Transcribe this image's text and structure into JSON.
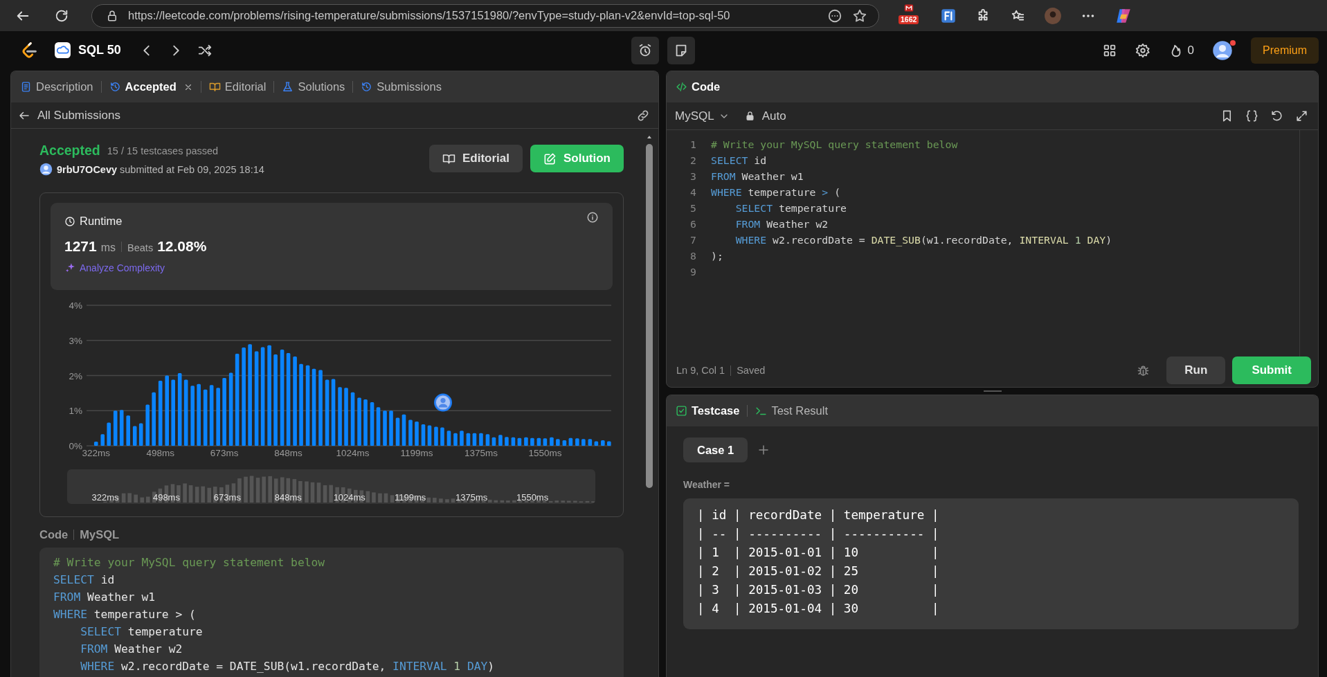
{
  "browser": {
    "url": "https://leetcode.com/problems/rising-temperature/submissions/1537151980/?envType=study-plan-v2&envId=top-sql-50",
    "mail_badge": "1662"
  },
  "navbar": {
    "study_plan": "SQL 50",
    "streak_count": "0",
    "premium_button": "Premium"
  },
  "left_panel": {
    "tabs": [
      {
        "label": "Description",
        "kind": "description",
        "selected": false,
        "closable": false
      },
      {
        "label": "Accepted",
        "kind": "history",
        "selected": true,
        "closable": true
      },
      {
        "label": "Editorial",
        "kind": "book",
        "selected": false,
        "closable": false
      },
      {
        "label": "Solutions",
        "kind": "flask",
        "selected": false,
        "closable": false
      },
      {
        "label": "Submissions",
        "kind": "history",
        "selected": false,
        "closable": false
      }
    ],
    "back_link": "All Submissions",
    "submission": {
      "status": "Accepted",
      "testcases": "15 / 15 testcases passed",
      "user": "9rbU7OCevy",
      "submitted": "submitted at Feb 09, 2025 18:14",
      "buttons": [
        {
          "label": "Editorial",
          "kind": "secondary"
        },
        {
          "label": "Solution",
          "kind": "primary"
        }
      ]
    },
    "runtime": {
      "title": "Runtime",
      "value": "1271",
      "unit": "ms",
      "beats_label": "Beats",
      "beats_value": "12.08%",
      "analyze_link": "Analyze Complexity",
      "chart_data": {
        "type": "bar",
        "x": [
          322,
          340,
          357,
          375,
          392,
          410,
          428,
          445,
          463,
          480,
          498,
          516,
          533,
          551,
          568,
          586,
          603,
          621,
          638,
          656,
          673,
          691,
          708,
          726,
          743,
          761,
          778,
          796,
          813,
          831,
          848,
          866,
          883,
          901,
          918,
          936,
          954,
          971,
          989,
          1006,
          1024,
          1042,
          1059,
          1077,
          1094,
          1112,
          1129,
          1147,
          1164,
          1182,
          1199,
          1217,
          1234,
          1252,
          1269,
          1287,
          1305,
          1322,
          1340,
          1357,
          1375,
          1393,
          1410,
          1428,
          1445,
          1463,
          1480,
          1498,
          1515,
          1533,
          1550,
          1568,
          1585,
          1603,
          1620,
          1638,
          1655,
          1673,
          1690,
          1708,
          1725
        ],
        "values": [
          0.12,
          0.33,
          0.66,
          1.0,
          1.02,
          0.86,
          0.56,
          0.64,
          1.17,
          1.52,
          1.85,
          2.0,
          1.88,
          2.07,
          1.88,
          1.71,
          1.76,
          1.6,
          1.73,
          1.65,
          1.93,
          2.08,
          2.62,
          2.8,
          2.89,
          2.69,
          2.81,
          2.86,
          2.6,
          2.74,
          2.64,
          2.54,
          2.33,
          2.29,
          2.19,
          2.16,
          1.88,
          1.9,
          1.67,
          1.65,
          1.52,
          1.37,
          1.32,
          1.24,
          1.1,
          1.0,
          1.0,
          0.8,
          0.89,
          0.74,
          0.69,
          0.61,
          0.58,
          0.54,
          0.52,
          0.43,
          0.36,
          0.43,
          0.36,
          0.36,
          0.36,
          0.33,
          0.24,
          0.31,
          0.25,
          0.24,
          0.22,
          0.24,
          0.22,
          0.22,
          0.21,
          0.24,
          0.19,
          0.16,
          0.22,
          0.21,
          0.19,
          0.19,
          0.13,
          0.16,
          0.13
        ],
        "xlim": [
          296,
          1731
        ],
        "ylim": [
          0,
          4
        ],
        "grid": true,
        "yticks": [
          {
            "value": 0,
            "label": "0%"
          },
          {
            "value": 1,
            "label": "1%"
          },
          {
            "value": 2,
            "label": "2%"
          },
          {
            "value": 3,
            "label": "3%"
          },
          {
            "value": 4,
            "label": "4%"
          }
        ],
        "xticks": [
          {
            "value": 322,
            "label": "322ms"
          },
          {
            "value": 498,
            "label": "498ms"
          },
          {
            "value": 673,
            "label": "673ms"
          },
          {
            "value": 848,
            "label": "848ms"
          },
          {
            "value": 1024,
            "label": "1024ms"
          },
          {
            "value": 1199,
            "label": "1199ms"
          },
          {
            "value": 1375,
            "label": "1375ms"
          },
          {
            "value": 1550,
            "label": "1550ms"
          }
        ]
      },
      "navigator": {
        "labels": [
          "322ms",
          "498ms",
          "673ms",
          "848ms",
          "1024ms",
          "1199ms",
          "1375ms",
          "1550ms"
        ]
      }
    },
    "code_section": {
      "label": "Code",
      "language": "MySQL",
      "lines": [
        {
          "tokens": [
            {
              "text": "# Write your MySQL query statement below",
              "kind": "comment"
            }
          ]
        },
        {
          "tokens": [
            {
              "text": "SELECT",
              "kind": "keyword"
            },
            {
              "text": " id",
              "kind": "plain"
            }
          ]
        },
        {
          "tokens": [
            {
              "text": "FROM",
              "kind": "keyword"
            },
            {
              "text": " Weather w1",
              "kind": "plain"
            }
          ]
        },
        {
          "tokens": [
            {
              "text": "WHERE",
              "kind": "keyword"
            },
            {
              "text": " temperature > (",
              "kind": "plain"
            }
          ]
        },
        {
          "indented": true,
          "tokens": [
            {
              "text": "SELECT",
              "kind": "keyword"
            },
            {
              "text": " temperature",
              "kind": "plain"
            }
          ]
        },
        {
          "indented": true,
          "tokens": [
            {
              "text": "FROM",
              "kind": "keyword"
            },
            {
              "text": " Weather w2",
              "kind": "plain"
            }
          ]
        },
        {
          "indented": true,
          "tokens": [
            {
              "text": "WHERE",
              "kind": "keyword"
            },
            {
              "text": " w2.recordDate = DATE_SUB(w1.recordDate, ",
              "kind": "plain"
            },
            {
              "text": "INTERVAL",
              "kind": "keyword"
            },
            {
              "text": " 1",
              "kind": "number"
            },
            {
              "text": " DAY",
              "kind": "keyword"
            },
            {
              "text": ")",
              "kind": "plain"
            }
          ]
        }
      ]
    }
  },
  "editor": {
    "tab": "Code",
    "language": "MySQL",
    "mode": "Auto",
    "lines": [
      {
        "number": "1",
        "tokens": [
          {
            "text": "# Write your MySQL query statement below",
            "kind": "comment"
          }
        ]
      },
      {
        "number": "2",
        "tokens": [
          {
            "text": "SELECT",
            "kind": "keyword"
          },
          {
            "text": " id",
            "kind": "plain"
          }
        ]
      },
      {
        "number": "3",
        "tokens": [
          {
            "text": "FROM",
            "kind": "keyword"
          },
          {
            "text": " Weather w1",
            "kind": "plain"
          }
        ]
      },
      {
        "number": "4",
        "tokens": [
          {
            "text": "WHERE",
            "kind": "keyword"
          },
          {
            "text": " temperature ",
            "kind": "plain"
          },
          {
            "text": ">",
            "kind": "operator"
          },
          {
            "text": " (",
            "kind": "plain"
          }
        ]
      },
      {
        "number": "5",
        "indented": true,
        "tokens": [
          {
            "text": "SELECT",
            "kind": "keyword"
          },
          {
            "text": " temperature",
            "kind": "plain"
          }
        ]
      },
      {
        "number": "6",
        "indented": true,
        "tokens": [
          {
            "text": "FROM",
            "kind": "keyword"
          },
          {
            "text": " Weather w2",
            "kind": "plain"
          }
        ]
      },
      {
        "number": "7",
        "indented": true,
        "tokens": [
          {
            "text": "WHERE",
            "kind": "keyword"
          },
          {
            "text": " w2.recordDate = ",
            "kind": "plain"
          },
          {
            "text": "DATE_SUB",
            "kind": "function"
          },
          {
            "text": "(w1.recordDate, ",
            "kind": "plain"
          },
          {
            "text": "INTERVAL",
            "kind": "function"
          },
          {
            "text": " 1",
            "kind": "number"
          },
          {
            "text": " DAY",
            "kind": "function"
          },
          {
            "text": ")",
            "kind": "plain"
          }
        ]
      },
      {
        "number": "8",
        "tokens": [
          {
            "text": ");",
            "kind": "plain"
          }
        ]
      },
      {
        "number": "9"
      }
    ],
    "cursor": "Ln 9, Col 1",
    "save_state": "Saved",
    "buttons": [
      {
        "label": "Run",
        "kind": "secondary"
      },
      {
        "label": "Submit",
        "kind": "primary"
      }
    ]
  },
  "testcase_panel": {
    "tabs": [
      {
        "label": "Testcase",
        "kind": "testcase",
        "selected": true
      },
      {
        "label": "Test Result",
        "kind": "result",
        "selected": false
      }
    ],
    "cases": [
      {
        "label": "Case 1",
        "selected": true
      }
    ],
    "input_label": "Weather =",
    "input_lines": [
      "| id | recordDate | temperature |",
      "| -- | ---------- | ----------- |",
      "| 1  | 2015-01-01 | 10          |",
      "| 2  | 2015-01-02 | 25          |",
      "| 3  | 2015-01-03 | 20          |",
      "| 4  | 2015-01-04 | 30          |"
    ]
  }
}
